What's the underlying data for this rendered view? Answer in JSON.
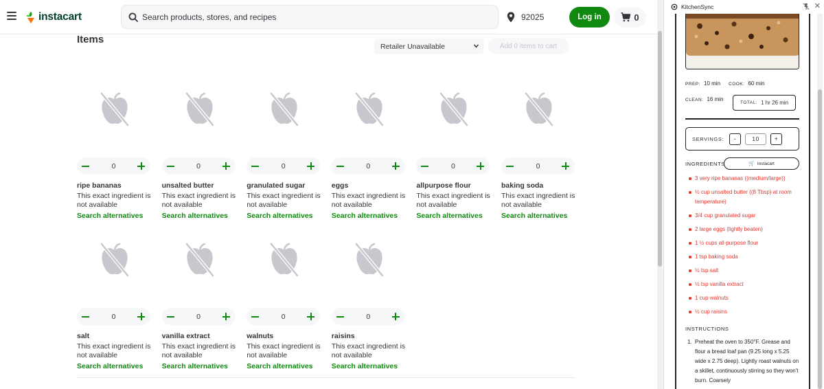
{
  "header": {
    "logo_text": "instacart",
    "search_placeholder": "Search products, stores, and recipes",
    "zip": "92025",
    "login_label": "Log in",
    "cart_count": "0",
    "brand_color": "#108910"
  },
  "main": {
    "title": "Items",
    "retailer_select": "Retailer Unavailable",
    "add_button": "Add 0 items to cart",
    "items": [
      {
        "name": "ripe bananas",
        "qty": "0",
        "desc": "This exact ingredient is not available",
        "alt": "Search alternatives"
      },
      {
        "name": "unsalted butter",
        "qty": "0",
        "desc": "This exact ingredient is not available",
        "alt": "Search alternatives"
      },
      {
        "name": "granulated sugar",
        "qty": "0",
        "desc": "This exact ingredient is not available",
        "alt": "Search alternatives"
      },
      {
        "name": "eggs",
        "qty": "0",
        "desc": "This exact ingredient is not available",
        "alt": "Search alternatives"
      },
      {
        "name": "allpurpose flour",
        "qty": "0",
        "desc": "This exact ingredient is not available",
        "alt": "Search alternatives"
      },
      {
        "name": "baking soda",
        "qty": "0",
        "desc": "This exact ingredient is not available",
        "alt": "Search alternatives"
      },
      {
        "name": "salt",
        "qty": "0",
        "desc": "This exact ingredient is not available",
        "alt": "Search alternatives"
      },
      {
        "name": "vanilla extract",
        "qty": "0",
        "desc": "This exact ingredient is not available",
        "alt": "Search alternatives"
      },
      {
        "name": "walnuts",
        "qty": "0",
        "desc": "This exact ingredient is not available",
        "alt": "Search alternatives"
      },
      {
        "name": "raisins",
        "qty": "0",
        "desc": "This exact ingredient is not available",
        "alt": "Search alternatives"
      }
    ]
  },
  "panel": {
    "title": "KitchenSync",
    "prep_label": "PREP:",
    "prep_value": "10 min",
    "cook_label": "COOK:",
    "cook_value": "60 min",
    "clean_label": "CLEAN:",
    "clean_value": "16 min",
    "total_label": "TOTAL:",
    "total_value": "1 hr 26 min",
    "servings_label": "SERVINGS:",
    "servings_minus": "-",
    "servings_value": "10",
    "servings_plus": "+",
    "ingredients_label": "INGREDIENTS",
    "instacart_button": "Instacart",
    "ingredients": [
      "3 very ripe bananas ((medium/large))",
      "½ cup unsalted butter ((8 Tbsp) at room temperature)",
      "3/4 cup granulated sugar",
      "2 large eggs (lightly beaten)",
      "1 ½ cups all-purpose flour",
      "1 tsp baking soda",
      "½ tsp salt",
      "½ tsp vanilla extract",
      "1 cup walnuts",
      "½ cup raisins"
    ],
    "instructions_label": "INSTRUCTIONS",
    "instructions": [
      {
        "num": "1.",
        "text": "Preheat the oven to 350°F. Grease and flour a bread loaf pan (9.25 long x 5.25 wide x 2.75 deep). Lightly roast walnuts on a skillet, continuously stirring so they won't burn. Coarsely"
      }
    ],
    "accent_color": "#e8342b"
  }
}
